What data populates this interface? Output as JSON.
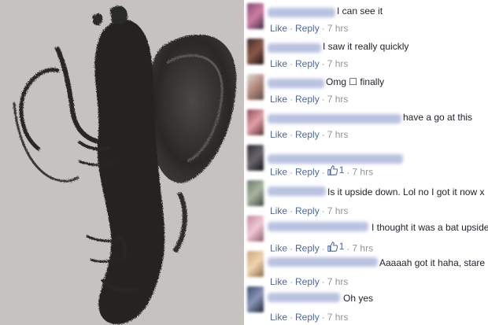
{
  "actions": {
    "like": "Like",
    "reply": "Reply",
    "dot": "·"
  },
  "comments": [
    {
      "text": "I can see it",
      "time": "7 hrs"
    },
    {
      "text": "I saw it really quickly",
      "time": "7 hrs"
    },
    {
      "text": "Omg ☐ finally",
      "time": "7 hrs"
    },
    {
      "text": "have a go at this",
      "time": "7 hrs"
    },
    {
      "text": "",
      "likes": "1",
      "time": "7 hrs"
    },
    {
      "text": "Is it upside down. Lol no I got it now x",
      "time": "7 hrs"
    },
    {
      "text": "I thought it was a bat upside",
      "likes": "1",
      "time": "7 hrs"
    },
    {
      "text": "Aaaaah got it haha, stare",
      "time": "7 hrs"
    },
    {
      "text": "Oh yes",
      "time": "7 hrs"
    }
  ],
  "colors": {
    "link": "#4b67a1",
    "meta": "#90949c",
    "text": "#1d2129",
    "name_blur": "#b9c2e0"
  },
  "icons": {
    "like_count": "thumbs-up-icon"
  }
}
